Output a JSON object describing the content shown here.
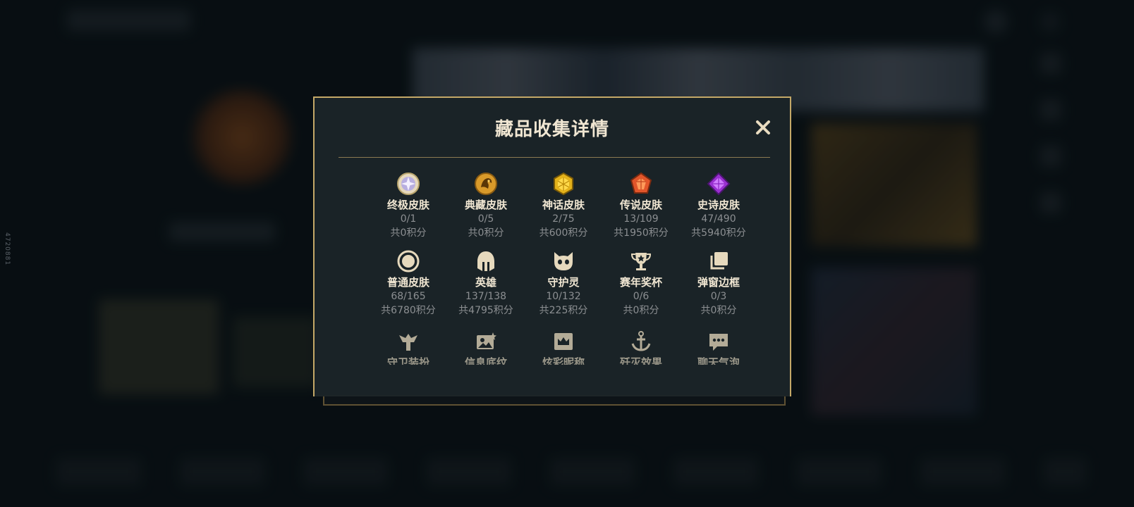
{
  "background": {
    "side_number": "4720881"
  },
  "modal": {
    "title": "藏品收集详情",
    "close_label": "✕",
    "items": [
      {
        "name": "终极皮肤",
        "count": "0/1",
        "points": "共0积分",
        "icon": "ultimate-skin-icon"
      },
      {
        "name": "典藏皮肤",
        "count": "0/5",
        "points": "共0积分",
        "icon": "prestige-skin-icon"
      },
      {
        "name": "神话皮肤",
        "count": "2/75",
        "points": "共600积分",
        "icon": "mythic-skin-icon"
      },
      {
        "name": "传说皮肤",
        "count": "13/109",
        "points": "共1950积分",
        "icon": "legendary-skin-icon"
      },
      {
        "name": "史诗皮肤",
        "count": "47/490",
        "points": "共5940积分",
        "icon": "epic-skin-icon"
      },
      {
        "name": "普通皮肤",
        "count": "68/165",
        "points": "共6780积分",
        "icon": "standard-skin-icon"
      },
      {
        "name": "英雄",
        "count": "137/138",
        "points": "共4795积分",
        "icon": "champion-helmet-icon"
      },
      {
        "name": "守护灵",
        "count": "10/132",
        "points": "共225积分",
        "icon": "guardian-spirit-icon"
      },
      {
        "name": "赛年奖杯",
        "count": "0/6",
        "points": "共0积分",
        "icon": "trophy-icon"
      },
      {
        "name": "弹窗边框",
        "count": "0/3",
        "points": "共0积分",
        "icon": "frame-icon"
      },
      {
        "name": "守卫装扮",
        "count": "",
        "points": "",
        "icon": "ward-skin-icon"
      },
      {
        "name": "信息底纹",
        "count": "",
        "points": "",
        "icon": "banner-icon"
      },
      {
        "name": "炫彩昵称",
        "count": "",
        "points": "",
        "icon": "nickname-crown-icon"
      },
      {
        "name": "歼灭效果",
        "count": "",
        "points": "",
        "icon": "finisher-anchor-icon"
      },
      {
        "name": "聊天气泡",
        "count": "",
        "points": "",
        "icon": "chat-bubble-icon"
      }
    ]
  },
  "colors": {
    "accent_gold": "#c4a867",
    "title_text": "#f0e6d2",
    "muted_text": "#8c8f92"
  }
}
